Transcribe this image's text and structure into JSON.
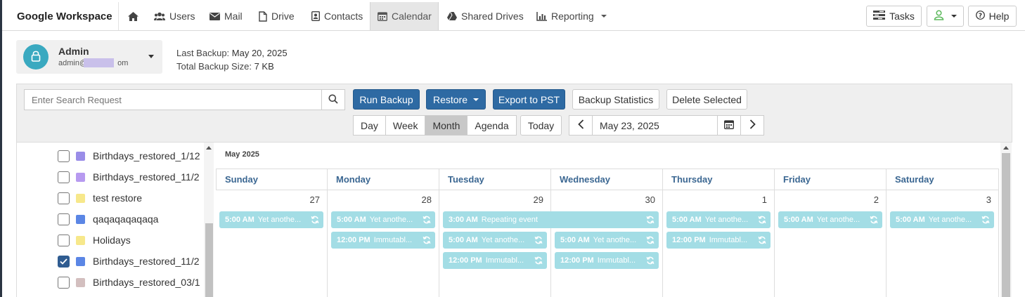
{
  "brand": "Google Workspace",
  "nav": {
    "home_icon": "home-icon",
    "items": [
      {
        "label": "Users",
        "icon": "users-icon"
      },
      {
        "label": "Mail",
        "icon": "envelope-icon"
      },
      {
        "label": "Drive",
        "icon": "file-icon"
      },
      {
        "label": "Contacts",
        "icon": "contact-card-icon"
      },
      {
        "label": "Calendar",
        "icon": "calendar-icon",
        "active": true
      },
      {
        "label": "Shared Drives",
        "icon": "drive-icon"
      },
      {
        "label": "Reporting",
        "icon": "bar-chart-icon",
        "has_dropdown": true
      }
    ],
    "right": {
      "tasks": "Tasks",
      "help": "Help"
    }
  },
  "account": {
    "name": "Admin",
    "email_visible_start": "admin@",
    "email_visible_end": "om"
  },
  "backup": {
    "last_label": "Last Backup:",
    "last_value": "May 20, 2025",
    "size_label": "Total Backup Size:",
    "size_value": "7 KB"
  },
  "toolbar": {
    "search_placeholder": "Enter Search Request",
    "run_backup": "Run Backup",
    "restore": "Restore",
    "export": "Export to PST",
    "stats": "Backup Statistics",
    "delete": "Delete Selected",
    "views": [
      "Day",
      "Week",
      "Month",
      "Agenda"
    ],
    "active_view": "Month",
    "today": "Today",
    "date_value": "May 23, 2025"
  },
  "calendars": [
    {
      "label": "Birthdays_restored_1/12",
      "color": "#9a8de8",
      "checked": false
    },
    {
      "label": "Birthdays_restored_11/2",
      "color": "#b79af0",
      "checked": false
    },
    {
      "label": "test restore",
      "color": "#f7e88b",
      "checked": false
    },
    {
      "label": "qaqaqaqaqaqa",
      "color": "#5b86e5",
      "checked": false
    },
    {
      "label": "Holidays",
      "color": "#f7e88b",
      "checked": false
    },
    {
      "label": "Birthdays_restored_11/2",
      "color": "#5b86e5",
      "checked": true
    },
    {
      "label": "Birthdays_restored_03/1",
      "color": "#d3bfbf",
      "checked": false
    }
  ],
  "calendar": {
    "month_label": "May 2025",
    "days": [
      "Sunday",
      "Monday",
      "Tuesday",
      "Wednesday",
      "Thursday",
      "Friday",
      "Saturday"
    ],
    "day_numbers": [
      "27",
      "28",
      "29",
      "30",
      "1",
      "2",
      "3"
    ],
    "events": [
      {
        "col": 0,
        "span": 1,
        "row": 0,
        "time": "5:00 AM",
        "title": "Yet anothe..."
      },
      {
        "col": 1,
        "span": 1,
        "row": 0,
        "time": "5:00 AM",
        "title": "Yet anothe..."
      },
      {
        "col": 1,
        "span": 1,
        "row": 1,
        "time": "12:00 PM",
        "title": "Immutabl..."
      },
      {
        "col": 2,
        "span": 2,
        "row": 0,
        "time": "3:00 AM",
        "title": "Repeating event"
      },
      {
        "col": 2,
        "span": 1,
        "row": 1,
        "time": "5:00 AM",
        "title": "Yet anothe..."
      },
      {
        "col": 2,
        "span": 1,
        "row": 2,
        "time": "12:00 PM",
        "title": "Immutabl..."
      },
      {
        "col": 3,
        "span": 1,
        "row": 1,
        "time": "5:00 AM",
        "title": "Yet anothe..."
      },
      {
        "col": 3,
        "span": 1,
        "row": 2,
        "time": "12:00 PM",
        "title": "Immutabl..."
      },
      {
        "col": 4,
        "span": 1,
        "row": 0,
        "time": "5:00 AM",
        "title": "Yet anothe..."
      },
      {
        "col": 4,
        "span": 1,
        "row": 1,
        "time": "12:00 PM",
        "title": "Immutabl..."
      },
      {
        "col": 5,
        "span": 1,
        "row": 0,
        "time": "5:00 AM",
        "title": "Yet anothe..."
      },
      {
        "col": 6,
        "span": 1,
        "row": 0,
        "time": "5:00 AM",
        "title": "Yet anothe..."
      }
    ]
  }
}
